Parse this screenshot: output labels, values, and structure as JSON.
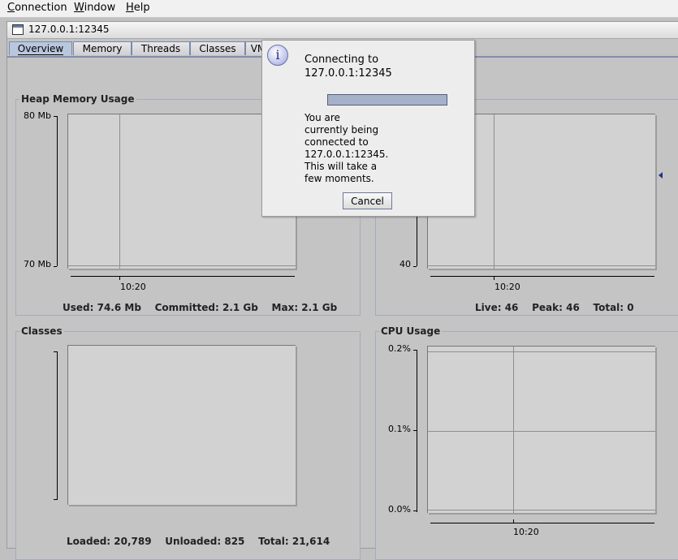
{
  "menubar": {
    "items": [
      {
        "first": "C",
        "rest": "onnection"
      },
      {
        "first": "W",
        "rest": "indow"
      },
      {
        "first": "H",
        "rest": "elp"
      }
    ]
  },
  "window": {
    "title": "127.0.0.1:12345"
  },
  "tabs": [
    {
      "label": "Overview"
    },
    {
      "label": "Memory"
    },
    {
      "label": "Threads"
    },
    {
      "label": "Classes"
    },
    {
      "label": "VM"
    }
  ],
  "panels": {
    "heap": {
      "title": "Heap Memory Usage",
      "y_top": "80 Mb",
      "y_bottom": "70 Mb",
      "x_label": "10:20",
      "footer": "Used: 74.6 Mb    Committed: 2.1 Gb    Max: 2.1 Gb"
    },
    "threads": {
      "y_bottom": "40",
      "x_label": "10:20",
      "footer": "Live: 46    Peak: 46    Total: 0"
    },
    "classes": {
      "title": "Classes",
      "footer": "Loaded: 20,789    Unloaded: 825    Total: 21,614"
    },
    "cpu": {
      "title": "CPU Usage",
      "y_top": "0.2%",
      "y_mid": "0.1%",
      "y_bottom": "0.0%",
      "x_label": "10:20"
    }
  },
  "dialog": {
    "icon": "info-icon",
    "heading_line1": "Connecting to",
    "heading_line2": "127.0.0.1:12345",
    "message_lines": [
      "You are",
      "currently being",
      "connected to",
      "127.0.0.1:12345.",
      "This will take a",
      "few moments."
    ],
    "progress": 1.0,
    "cancel_label": "Cancel"
  },
  "colors": {
    "background": "#c4c4c4",
    "accent": "#b9c7de",
    "progress": "#a4b1c8"
  }
}
